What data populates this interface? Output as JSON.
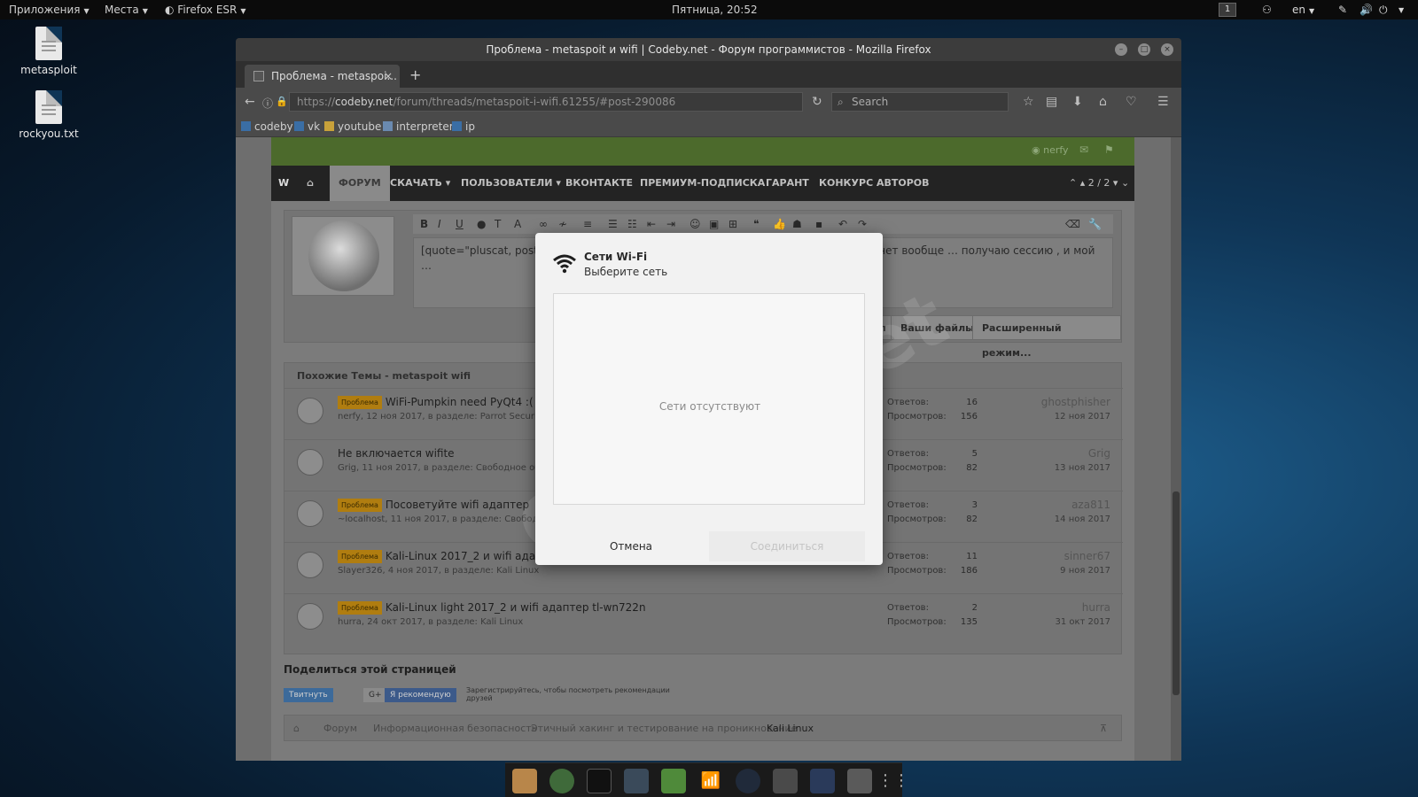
{
  "topbar": {
    "apps": "Приложения",
    "places": "Места",
    "firefox": "Firefox ESR",
    "clock": "Пятница, 20:52",
    "workspace": "1",
    "lang": "en"
  },
  "desktop": [
    {
      "label": "metasploit"
    },
    {
      "label": "rockyou.txt"
    }
  ],
  "window": {
    "title": "Проблема - metaspoit и wifi | Codeby.net - Форум программистов - Mozilla Firefox"
  },
  "tab": {
    "label": "Проблема - metaspoi...",
    "close": "×",
    "new": "+"
  },
  "nav": {
    "url_host": "codeby.net",
    "url_prefix": "https://",
    "url_path": "/forum/threads/metaspoit-i-wifi.61255/#post-290086",
    "search_placeholder": "Search"
  },
  "bookmarks": [
    "codeby",
    "vk",
    "youtube",
    "interpreter",
    "ip"
  ],
  "site": {
    "user": "nerfy",
    "menu": [
      "ФОРУМ",
      "СКАЧАТЬ",
      "ПОЛЬЗОВАТЕЛИ",
      "ВКОНТАКТЕ",
      "ПРЕМИУМ-ПОДПИСКА",
      "ГАРАНТ",
      "КОНКУРС АВТОРОВ"
    ],
    "pager": "2 / 2",
    "editor_text": "[quote=\"pluscat, post: 290 … сессия wifi или полностью крешится адаптер, интернет вообще … получаю сессию , и мой …",
    "editor_buttons": [
      "ил",
      "Ваши файлы",
      "Расширенный режим..."
    ],
    "similar_header": "Похожие Темы - metaspoit wifi",
    "badge": "Проблема",
    "replies_label": "Ответов:",
    "views_label": "Просмотров:",
    "threads": [
      {
        "title": "WiFi-Pumpkin need PyQt4 :(",
        "meta": "nerfy, 12 ноя 2017, в разделе: Parrot Security OS",
        "badge": true,
        "replies": "16",
        "views": "156",
        "last_user": "ghostphisher",
        "last_date": "12 ноя 2017"
      },
      {
        "title": "Не включается wifite",
        "meta": "Grig, 11 ноя 2017, в разделе: Свободное общение",
        "badge": false,
        "replies": "5",
        "views": "82",
        "last_user": "Grig",
        "last_date": "13 ноя 2017"
      },
      {
        "title": "Посоветуйте wifi адаптер",
        "meta": "~localhost, 11 ноя 2017, в разделе: Свободное общение",
        "badge": true,
        "replies": "3",
        "views": "82",
        "last_user": "aza811",
        "last_date": "14 ноя 2017"
      },
      {
        "title": "Kali-Linux 2017_2 и wifi адаптер tl-wn722n",
        "meta": "Slayer326, 4 ноя 2017, в разделе: Kali Linux",
        "badge": true,
        "replies": "11",
        "views": "186",
        "last_user": "sinner67",
        "last_date": "9 ноя 2017"
      },
      {
        "title": "Kali-Linux light 2017_2 и wifi адаптер tl-wn722n",
        "meta": "hurra, 24 окт 2017, в разделе: Kali Linux",
        "badge": true,
        "replies": "2",
        "views": "135",
        "last_user": "hurra",
        "last_date": "31 окт 2017"
      }
    ],
    "share_title": "Поделиться этой страницей",
    "share_buttons": [
      "Твитнуть",
      "G+",
      "Я рекомендую"
    ],
    "share_note": "Зарегистрируйтесь, чтобы посмотреть рекомендации друзей",
    "breadcrumb": [
      "Форум",
      "Информационная безопасность",
      "Этичный хакинг и тестирование на проникновение",
      "Kali Linux"
    ],
    "watermark": "Codeby.net"
  },
  "dialog": {
    "title": "Сети Wi-Fi",
    "subtitle": "Выберите сеть",
    "empty": "Сети отсутствуют",
    "cancel": "Отмена",
    "connect": "Соединиться"
  },
  "colors": {
    "accent_green": "#4c6a2c",
    "badge": "#b07d10",
    "desktop": "#0f3556"
  }
}
